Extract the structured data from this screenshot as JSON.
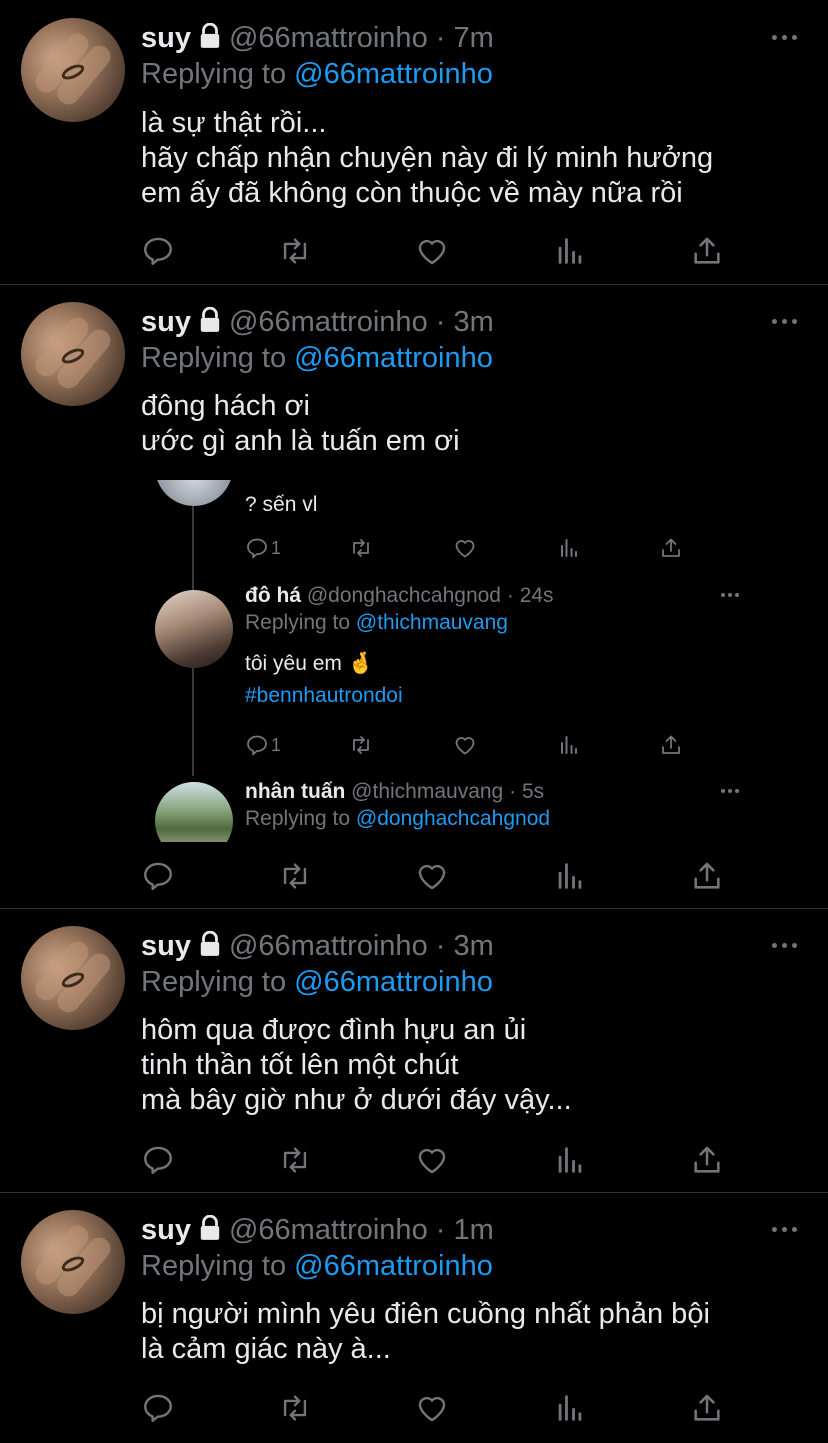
{
  "tweets": [
    {
      "name": "suy",
      "handle": "@66mattroinho",
      "time": "7m",
      "replying_prefix": "Replying to",
      "replying_to": "@66mattroinho",
      "lines": [
        "là sự thật rồi...",
        "hãy chấp nhận chuyện này đi lý minh hưởng",
        "em ấy đã không còn thuộc về mày nữa rồi"
      ]
    },
    {
      "name": "suy",
      "handle": "@66mattroinho",
      "time": "3m",
      "replying_prefix": "Replying to",
      "replying_to": "@66mattroinho",
      "lines": [
        "đông hách ơi",
        "ước gì anh là tuấn em ơi"
      ]
    },
    {
      "name": "suy",
      "handle": "@66mattroinho",
      "time": "3m",
      "replying_prefix": "Replying to",
      "replying_to": "@66mattroinho",
      "lines": [
        "hôm qua được đình hựu an ủi",
        "tinh thần tốt lên một chút",
        "mà bây giờ như ở dưới đáy vậy..."
      ]
    },
    {
      "name": "suy",
      "handle": "@66mattroinho",
      "time": "1m",
      "replying_prefix": "Replying to",
      "replying_to": "@66mattroinho",
      "lines": [
        "bị người mình yêu điên cuồng nhất phản bội",
        "là cảm giác này à..."
      ]
    }
  ],
  "embedded": {
    "first": {
      "text": "? sến vl",
      "reply_count": "1"
    },
    "second": {
      "name": "đô há",
      "handle": "@donghachcahgnod",
      "time": "24s",
      "replying_prefix": "Replying to",
      "replying_to": "@thichmauvang",
      "text": "tôi yêu em",
      "emoji": "🤞",
      "hashtag": "#bennhautrondoi",
      "reply_count": "1"
    },
    "third": {
      "name": "nhân tuấn",
      "handle": "@thichmauvang",
      "time": "5s",
      "replying_prefix": "Replying to",
      "replying_to": "@donghachcahgnod"
    }
  },
  "separator": "·",
  "colors": {
    "background": "#000000",
    "text": "#e7e9ea",
    "muted": "#71767b",
    "accent": "#1d9bf0",
    "divider": "#2f3336"
  },
  "icons": [
    "reply-icon",
    "retweet-icon",
    "like-icon",
    "analytics-icon",
    "share-icon",
    "more-icon",
    "lock-icon"
  ]
}
